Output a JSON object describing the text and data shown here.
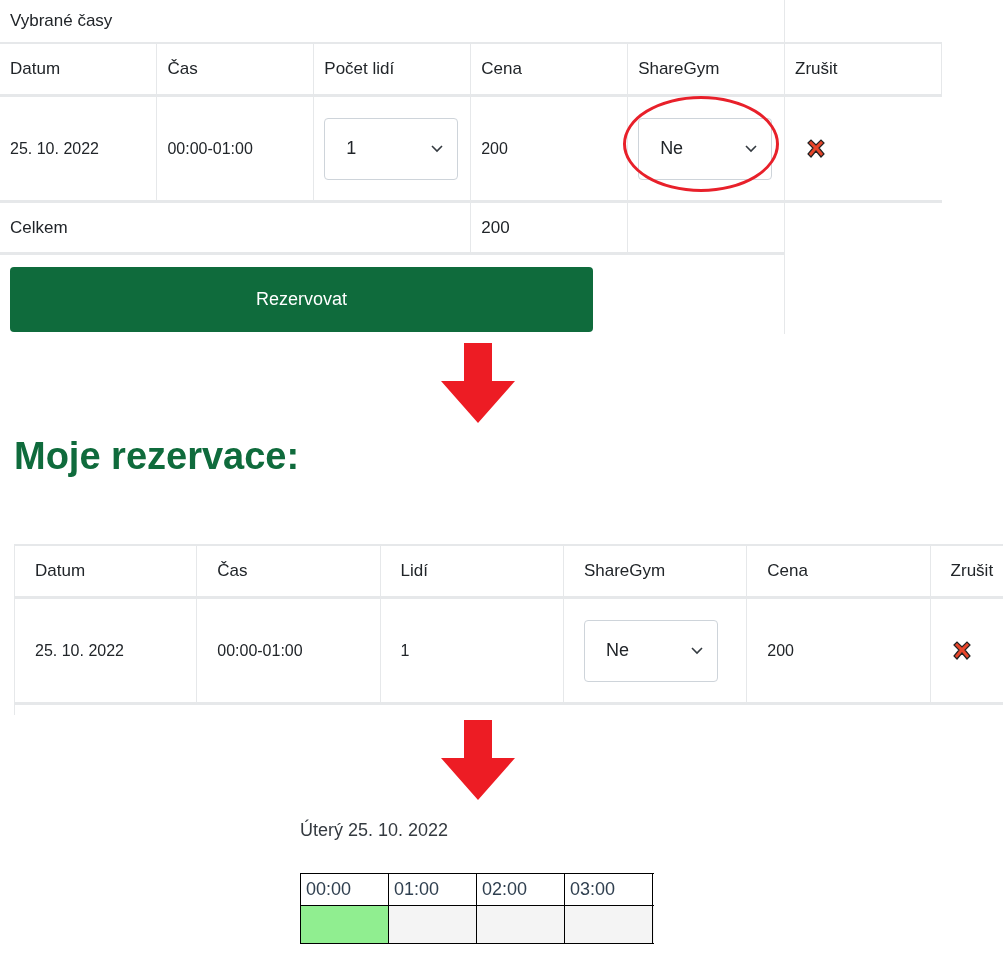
{
  "selected_times": {
    "title": "Vybrané časy",
    "columns": [
      "Datum",
      "Čas",
      "Počet lidí",
      "Cena",
      "ShareGym",
      "Zrušit"
    ],
    "rows": [
      {
        "date": "25. 10. 2022",
        "time": "00:00-01:00",
        "people": "1",
        "price": "200",
        "sharegym": "Ne",
        "sharegym_circled": true
      }
    ],
    "total": {
      "label": "Celkem",
      "price": "200"
    },
    "reserve_button": "Rezervovat"
  },
  "my_reservations": {
    "title": "Moje rezervace:",
    "columns": [
      "Datum",
      "Čas",
      "Lidí",
      "ShareGym",
      "Cena",
      "Zrušit"
    ],
    "rows": [
      {
        "date": "25. 10. 2022",
        "time": "00:00-01:00",
        "people": "1",
        "sharegym": "Ne",
        "price": "200"
      }
    ]
  },
  "schedule": {
    "day": "Úterý 25. 10. 2022",
    "slots": [
      {
        "time": "00:00",
        "selected": true
      },
      {
        "time": "01:00",
        "selected": false
      },
      {
        "time": "02:00",
        "selected": false
      },
      {
        "time": "03:00",
        "selected": false
      }
    ]
  }
}
